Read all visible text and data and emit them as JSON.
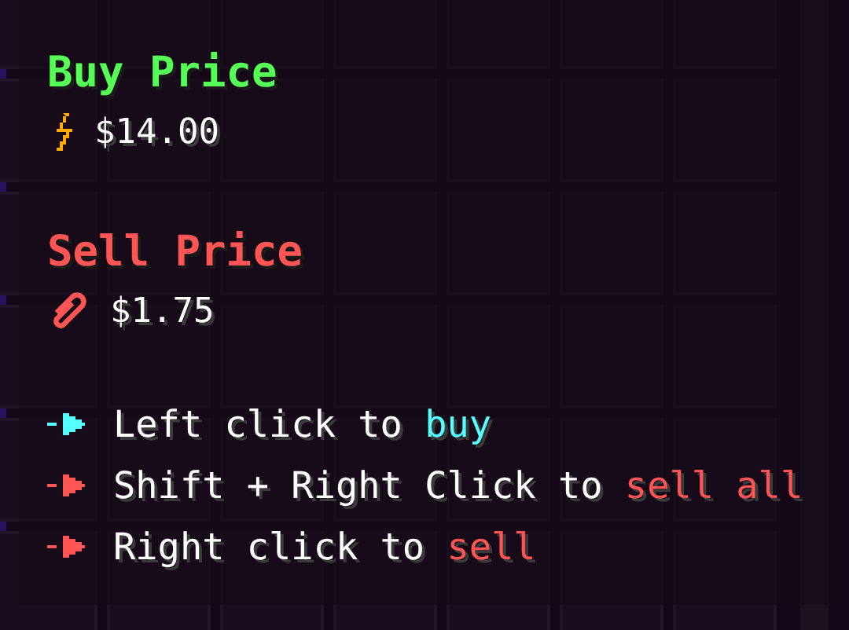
{
  "tooltip": {
    "prices": [
      {
        "kind": "buy",
        "title": "Buy Price",
        "value": "$14.00"
      },
      {
        "kind": "sell",
        "title": "Sell Price",
        "value": "$1.75"
      }
    ],
    "actions": [
      {
        "text": "Left click to",
        "highlight": "buy",
        "color": "#55ffff"
      },
      {
        "text": "Shift + Right Click to",
        "highlight": "sell all",
        "color": "#ff5555"
      },
      {
        "text": "Right click to",
        "highlight": "sell",
        "color": "#ff5555"
      }
    ]
  }
}
